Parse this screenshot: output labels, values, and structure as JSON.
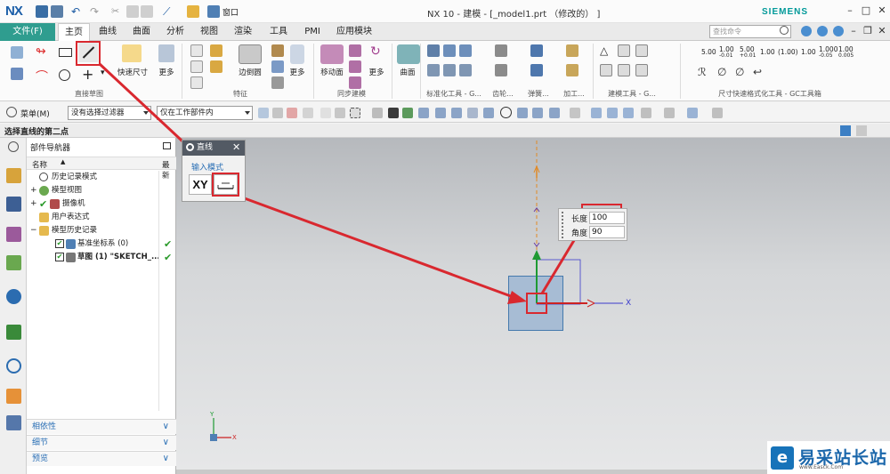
{
  "titlebar": {
    "logo": "NX",
    "title": "NX 10 - 建模 - [_model1.prt （修改的） ]",
    "brand": "SIEMENS",
    "window_combo": "窗口"
  },
  "menubar": {
    "file": "文件(F)",
    "tabs": [
      "主页",
      "曲线",
      "曲面",
      "分析",
      "视图",
      "渲染",
      "工具",
      "PMI",
      "应用模块"
    ],
    "active_tab": "主页",
    "search_placeholder": "查找命令"
  },
  "ribbon": {
    "labels": {
      "quick_dim": "快速尺寸",
      "more1": "更多",
      "edge_blend": "边倒圆",
      "more2": "更多",
      "move_face": "移动面",
      "more3": "更多",
      "surface": "曲面"
    },
    "groups": {
      "direct_sketch": "直接草图",
      "feature": "特征",
      "sync_modeling": "同步建模",
      "std_tools": "标准化工具 - G...",
      "gear": "齿轮...",
      "spring": "弹簧...",
      "machining": "加工...",
      "modeling_tools": "建模工具 - G...",
      "dim_format": "尺寸快速格式化工具 - GC工具箱"
    },
    "dim_buttons": [
      "5.00",
      "1.00",
      "5.00",
      "1.00",
      "(1.00)",
      "1.00",
      "1.000",
      "1.00"
    ],
    "dim_button_subs": [
      "",
      "-0.01",
      "+0.01",
      "",
      "",
      "",
      "-0.05",
      "0.005"
    ]
  },
  "filterbar": {
    "menu": "菜单(M)",
    "selection_filter": "没有选择过滤器",
    "scope": "仅在工作部件内"
  },
  "status": {
    "prompt": "选择直线的第二点"
  },
  "navigator": {
    "title": "部件导航器",
    "col_name": "名称",
    "col_latest": "最新",
    "rows": [
      {
        "label": "历史记录模式",
        "check": false
      },
      {
        "label": "模型视图",
        "check": false
      },
      {
        "label": "摄像机",
        "check": false
      },
      {
        "label": "用户表达式",
        "check": false
      },
      {
        "label": "模型历史记录",
        "check": false
      },
      {
        "label": "基准坐标系 (0)",
        "check": true
      },
      {
        "label": "草图 (1) \"SKETCH_...",
        "check": true
      }
    ],
    "panels": [
      "相依性",
      "细节",
      "预览"
    ]
  },
  "dialog": {
    "title": "直线",
    "section": "输入模式",
    "xy": "XY"
  },
  "entry": {
    "length_label": "长度",
    "length_value": "100",
    "angle_label": "角度",
    "angle_value": "90"
  },
  "csys": {
    "x_label": "X",
    "x_label_small": "X",
    "y_label_small": "Y"
  },
  "watermark": {
    "logo_char": "e",
    "text": "易采站长站",
    "url": "www.Easck.Com"
  },
  "colors": {
    "accent": "#2f9d8f",
    "annotation": "#d9282f",
    "sketch_fill": "#a7bcd4",
    "axis_green": "#1e9a33",
    "axis_red": "#cc2222",
    "axis_blue": "#3b3bcc",
    "dashed_orange": "#e18a26"
  }
}
